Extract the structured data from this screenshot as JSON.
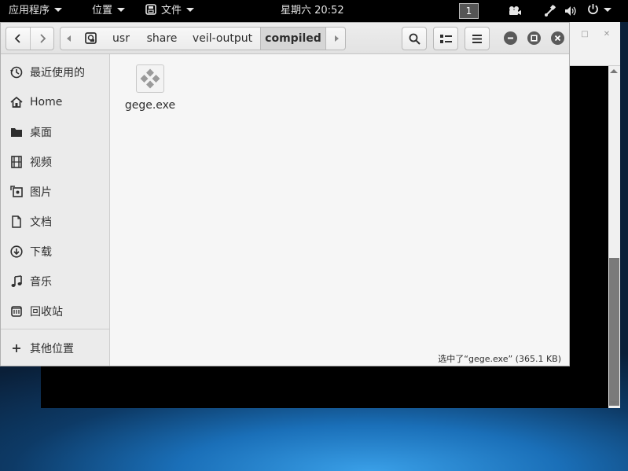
{
  "topbar": {
    "apps_label": "应用程序",
    "places_label": "位置",
    "files_label": "文件",
    "clock": "星期六 20:52",
    "workspace": "1"
  },
  "headerbar": {
    "path_segments": [
      "usr",
      "share",
      "veil-output",
      "compiled"
    ]
  },
  "sidebar": {
    "items": [
      {
        "label": "最近使用的",
        "icon": "clock-icon"
      },
      {
        "label": "Home",
        "icon": "home-icon"
      },
      {
        "label": "桌面",
        "icon": "desktop-icon"
      },
      {
        "label": "视频",
        "icon": "video-icon"
      },
      {
        "label": "图片",
        "icon": "picture-icon"
      },
      {
        "label": "文档",
        "icon": "document-icon"
      },
      {
        "label": "下载",
        "icon": "download-icon"
      },
      {
        "label": "音乐",
        "icon": "music-icon"
      },
      {
        "label": "回收站",
        "icon": "trash-icon"
      }
    ],
    "other_locations": "其他位置"
  },
  "files": [
    {
      "name": "gege.exe",
      "icon": "executable-icon"
    }
  ],
  "status": {
    "selection": "选中了“gege.exe” (365.1 KB)"
  }
}
